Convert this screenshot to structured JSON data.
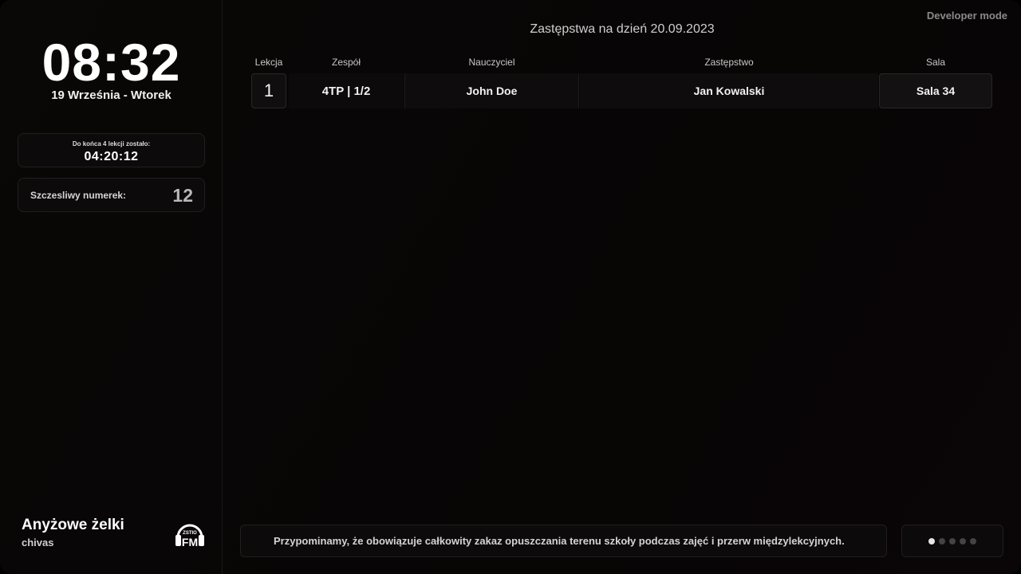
{
  "sidebar": {
    "clock": "08:32",
    "date": "19 Września - Wtorek",
    "countdown": {
      "label": "Do końca 4 lekcji zostało:",
      "value": "04:20:12"
    },
    "lucky_number": {
      "label": "Szczesliwy numerek:",
      "value": "12"
    },
    "radio": {
      "title": "Anyżowe żelki",
      "artist": "chivas",
      "logo_icon": "zstio-fm-headphones-icon",
      "logo_text_top": "ZSTIO",
      "logo_text_main": "FM"
    }
  },
  "main": {
    "developer_mode": "Developer mode",
    "heading": "Zastępstwa na dzień 20.09.2023",
    "columns": [
      "Lekcja",
      "Zespół",
      "Nauczyciel",
      "Zastępstwo",
      "Sala"
    ],
    "rows": [
      {
        "lesson": "1",
        "team": "4TP | 1/2",
        "teacher": "John Doe",
        "substitute": "Jan Kowalski",
        "room": "Sala 34"
      }
    ],
    "notice": "Przypominamy, że obowiązuje całkowity zakaz opuszczania terenu szkoły podczas zajęć i przerw międzylekcyjnych.",
    "pager": {
      "total": 5,
      "active": 1
    }
  }
}
